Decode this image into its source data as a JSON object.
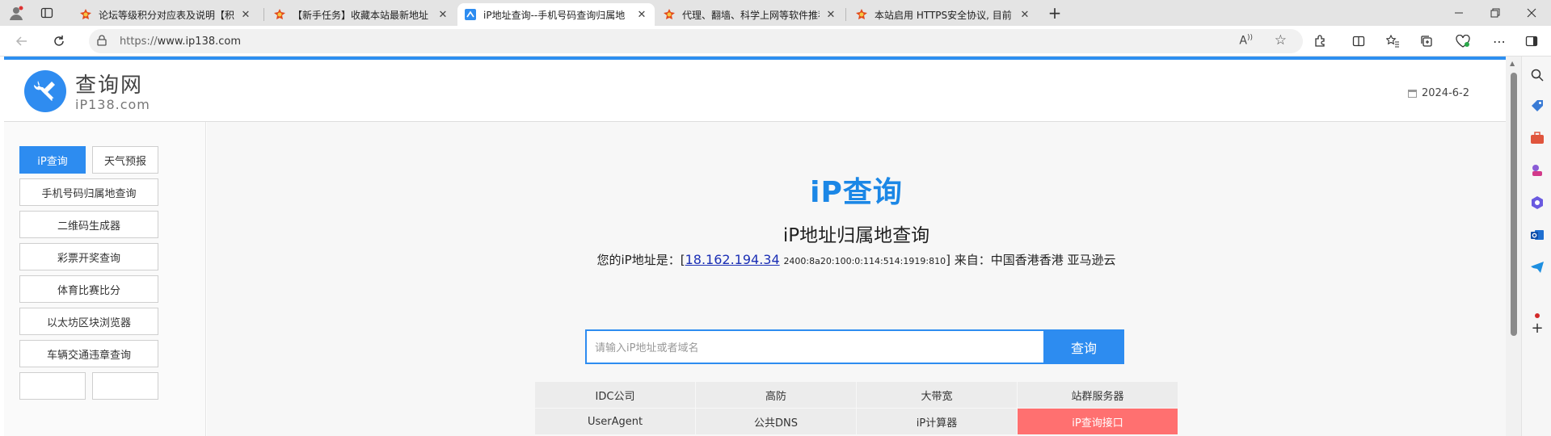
{
  "browser": {
    "tabs": [
      {
        "title": "论坛等级积分对应表及说明【积分",
        "favicon": "forum-favicon"
      },
      {
        "title": "【新手任务】收藏本站最新地址",
        "favicon": "forum-favicon"
      },
      {
        "title": "iP地址查询--手机号码查询归属地",
        "favicon": "ip138-favicon",
        "active": true
      },
      {
        "title": "代理、翻墙、科学上网等软件推荐",
        "favicon": "forum-favicon"
      },
      {
        "title": "本站启用 HTTPS安全协议, 目前",
        "favicon": "forum-favicon"
      }
    ],
    "new_tab": "+",
    "url": {
      "protocol": "https://",
      "host": "www.ip138.com"
    },
    "read_aloud": "A",
    "colors": {
      "accent": "#2d8cf0",
      "tab_bar": "#e4e4e4"
    }
  },
  "header": {
    "logo_title": "查询网",
    "logo_sub": "iP138.com",
    "date": "2024-6-2"
  },
  "sidebar": {
    "tabs": [
      "iP查询",
      "天气预报"
    ],
    "items": [
      "手机号码归属地查询",
      "二维码生成器",
      "彩票开奖查询",
      "体育比赛比分",
      "以太坊区块浏览器",
      "车辆交通违章查询"
    ]
  },
  "main": {
    "hero_title": "iP查询",
    "subtitle": "iP地址归属地查询",
    "ip_prefix": "您的iP地址是：[",
    "ipv4": "18.162.194.34",
    "ipv6": "2400:8a20:100:0:114:514:1919:810",
    "ip_suffix": "] 来自：中国香港香港 亚马逊云",
    "search_placeholder": "请输入iP地址或者域名",
    "search_button": "查询",
    "grid": [
      [
        "IDC公司",
        "高防",
        "大带宽",
        "站群服务器"
      ],
      [
        "UserAgent",
        "公共DNS",
        "iP计算器",
        "iP查询接口"
      ]
    ],
    "hot_color": "#ff7070"
  }
}
